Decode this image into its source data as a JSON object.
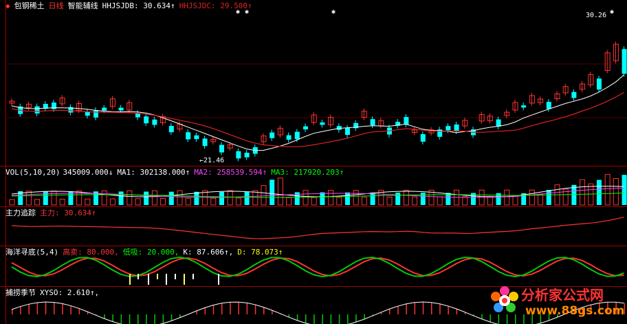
{
  "main": {
    "stock_icon": "red-diamond-icon",
    "stock_name": "包钢稀土",
    "period": "日线",
    "indicator": "智能辅线",
    "hhjsjdb": "HHJSJDB: 30.634↑",
    "hhjsjdc": "HHJSJDC: 29.500↑",
    "low_label": "←21.46",
    "high_label": "30.26"
  },
  "vol": {
    "label": "VOL(5,10,20)",
    "value": "345009.000↓",
    "ma1": "MA1: 302138.000↑",
    "ma2": "MA2: 258539.594↑",
    "ma3": "MA3: 217920.203↑"
  },
  "zhuli": {
    "label": "主力追踪",
    "value": "主力: 30.634↑"
  },
  "haiyang": {
    "label": "海洋寻底(5,4)",
    "high": "高卖: 80.000,",
    "low": "低吸: 20.000,",
    "k": "K: 87.606↑,",
    "d": "D: 78.073↑"
  },
  "bulao": {
    "label": "捕捞季节",
    "xyso": "XYSO: 2.610↑,"
  },
  "watermark": {
    "line1": "分析家公式网",
    "line2": "www.88gs.com"
  },
  "colors": {
    "up": "#ff3333",
    "down": "#00ffff",
    "grid": "#a00000",
    "ma_white": "#ffffff",
    "ma_red": "#dd2222",
    "text_white": "#ffffff",
    "text_magenta": "#ff44ff",
    "text_yellow": "#ffff00",
    "text_green": "#00ff00",
    "text_red": "#ff3333"
  }
}
